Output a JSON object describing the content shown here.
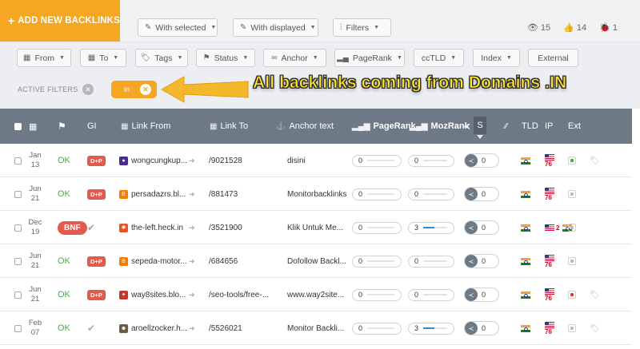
{
  "toolbar": {
    "add_label": "ADD NEW BACKLINKS",
    "with_selected": "With selected",
    "with_displayed": "With displayed",
    "filters": "Filters",
    "views_count": "15",
    "likes_count": "14",
    "bugs_count": "1"
  },
  "filters": {
    "from": "From",
    "to": "To",
    "tags": "Tags",
    "status": "Status",
    "anchor": "Anchor",
    "pagerank": "PageRank",
    "cctld": "ccTLD",
    "index": "Index",
    "external": "External"
  },
  "active_filters": {
    "label": "ACTIVE FILTERS",
    "chip": "in",
    "annotation": "All backlinks coming from Domains .IN"
  },
  "table": {
    "headers": {
      "gi": "GI",
      "link_from": "Link From",
      "link_to": "Link To",
      "anchor": "Anchor text",
      "pagerank": "PageRank",
      "mozrank": "MozRank",
      "s": "S",
      "tld": "TLD",
      "ip": "IP",
      "ext": "Ext"
    },
    "rows": [
      {
        "month": "Jan",
        "day": "13",
        "status": "OK",
        "gi": "D+P",
        "favicon": "globe-icon",
        "fav_color": "#4a2a8a",
        "link_from": "wongcungkup...",
        "link_to": "/9021528",
        "anchor": "disini",
        "pr": "0",
        "pr_fill": 0,
        "mr": "0",
        "mr_fill": 0,
        "shares": "0",
        "ip_count": "76",
        "ip_extra": "",
        "ext_color": "#3fb33f",
        "tagged": true
      },
      {
        "month": "Jun",
        "day": "21",
        "status": "OK",
        "gi": "D+P",
        "favicon": "blogger-icon",
        "fav_color": "#f57d00",
        "link_from": "persadazrs.bl...",
        "link_to": "/881473",
        "anchor": "Monitorbacklinks",
        "pr": "0",
        "pr_fill": 0,
        "mr": "0",
        "mr_fill": 0,
        "shares": "0",
        "ip_count": "76",
        "ip_extra": "",
        "ext_color": "#bbbbbb",
        "tagged": false
      },
      {
        "month": "Dec",
        "day": "19",
        "status": "BNF",
        "gi": "✔",
        "favicon": "fire-icon",
        "fav_color": "#e8541f",
        "link_from": "the-left.heck.in",
        "link_to": "/3521900",
        "anchor": "Klik Untuk Me...",
        "pr": "0",
        "pr_fill": 0,
        "mr": "3",
        "mr_fill": 0.45,
        "shares": "0",
        "ip_count": "",
        "ip_extra": "2",
        "ext_color": "#bbbbbb",
        "tagged": false
      },
      {
        "month": "Jun",
        "day": "21",
        "status": "OK",
        "gi": "D+P",
        "favicon": "blogger-icon",
        "fav_color": "#f57d00",
        "link_from": "sepeda-motor...",
        "link_to": "/684656",
        "anchor": "Dofollow Backl...",
        "pr": "0",
        "pr_fill": 0,
        "mr": "0",
        "mr_fill": 0,
        "shares": "0",
        "ip_count": "76",
        "ip_extra": "",
        "ext_color": "#bbbbbb",
        "tagged": false
      },
      {
        "month": "Jun",
        "day": "21",
        "status": "OK",
        "gi": "D+P",
        "favicon": "bird-icon",
        "fav_color": "#c0392b",
        "link_from": "way8sites.blo...",
        "link_to": "/seo-tools/free-...",
        "anchor": "www.way2site...",
        "pr": "0",
        "pr_fill": 0,
        "mr": "0",
        "mr_fill": 0,
        "shares": "0",
        "ip_count": "76",
        "ip_extra": "",
        "ext_color": "#e03a3a",
        "tagged": true
      },
      {
        "month": "Feb",
        "day": "07",
        "status": "OK",
        "gi": "✔",
        "favicon": "avatar-icon",
        "fav_color": "#6b5a45",
        "link_from": "aroellzocker.h...",
        "link_to": "/5526021",
        "anchor": "Monitor Backli...",
        "pr": "0",
        "pr_fill": 0,
        "mr": "3",
        "mr_fill": 0.45,
        "shares": "0",
        "ip_count": "76",
        "ip_extra": "",
        "ext_color": "#bbbbbb",
        "tagged": true
      }
    ]
  }
}
